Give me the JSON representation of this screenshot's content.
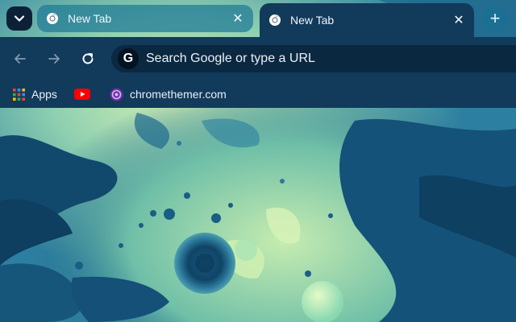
{
  "tabs": [
    {
      "title": "New Tab",
      "active": false,
      "icon": "chrome-icon"
    },
    {
      "title": "New Tab",
      "active": true,
      "icon": "chrome-icon"
    }
  ],
  "tab_controls": {
    "close_glyph": "✕",
    "new_tab_glyph": "+",
    "tab_search_icon": "chevron-down-icon"
  },
  "toolbar": {
    "back_icon": "back-arrow-icon",
    "forward_icon": "forward-arrow-icon",
    "reload_icon": "reload-icon",
    "search_engine_badge": "G",
    "omnibox_placeholder": "Search Google or type a URL"
  },
  "bookmarks": [
    {
      "label": "Apps",
      "icon": "apps-grid-icon"
    },
    {
      "label": "",
      "icon": "youtube-icon"
    },
    {
      "label": "chromethemer.com",
      "icon": "chromethemer-icon"
    }
  ],
  "colors": {
    "frame": "#0c2138",
    "toolbar": "#123a5b",
    "inactive_tab": "#1e7896",
    "omnibox": "#0b2841",
    "text": "#e8f1f7"
  }
}
